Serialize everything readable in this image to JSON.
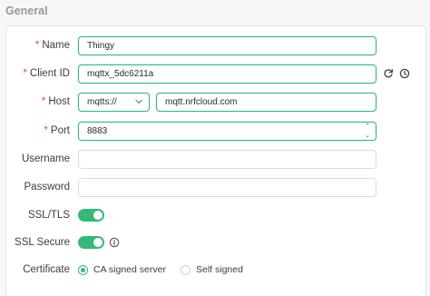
{
  "section": {
    "title": "General"
  },
  "fields": {
    "name": {
      "label": "Name",
      "required_mark": "*",
      "value": "Thingy"
    },
    "client_id": {
      "label": "Client ID",
      "required_mark": "*",
      "value": "mqttx_5dc6211a"
    },
    "host": {
      "label": "Host",
      "required_mark": "*",
      "protocol": "mqtts://",
      "value": "mqtt.nrfcloud.com"
    },
    "port": {
      "label": "Port",
      "required_mark": "*",
      "value": "8883"
    },
    "username": {
      "label": "Username",
      "value": ""
    },
    "password": {
      "label": "Password",
      "value": ""
    },
    "ssl_tls": {
      "label": "SSL/TLS",
      "enabled": true
    },
    "ssl_secure": {
      "label": "SSL Secure",
      "enabled": true
    },
    "certificate": {
      "label": "Certificate",
      "options": [
        {
          "label": "CA signed server",
          "selected": true
        },
        {
          "label": "Self signed",
          "selected": false
        }
      ]
    }
  },
  "icons": {
    "refresh": "refresh-icon",
    "history": "clock-icon",
    "info": "info-icon",
    "dropdown": "chevron-down-icon"
  },
  "colors": {
    "accent": "#34b97a",
    "required": "#e5483f",
    "section_title": "#979797"
  }
}
